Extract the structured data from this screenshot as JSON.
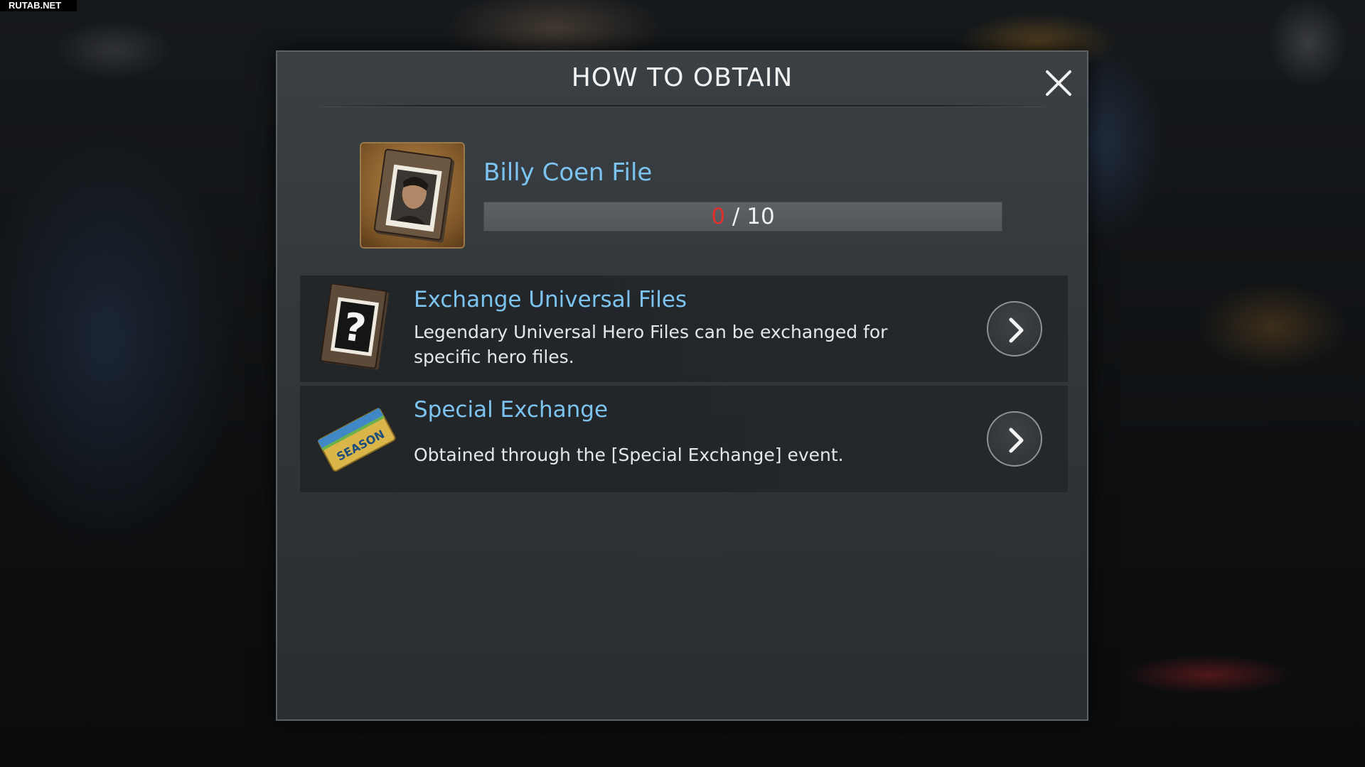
{
  "watermark": "RUTAB.NET",
  "dialog": {
    "title": "HOW TO OBTAIN",
    "close_icon": "close-icon"
  },
  "item": {
    "name": "Billy Coen File",
    "icon": "hero-file-portrait-icon",
    "owned": "0",
    "separator": " / ",
    "required": "10",
    "progress_fraction": 0
  },
  "sources": [
    {
      "title": "Exchange Universal Files",
      "description": "Legendary Universal Hero Files can be exchanged for specific hero files.",
      "icon": "universal-file-question-icon",
      "action_icon": "chevron-right-icon"
    },
    {
      "title": "Special Exchange",
      "description": "Obtained through the [Special Exchange] event.",
      "icon": "season-ticket-icon",
      "action_icon": "chevron-right-icon"
    }
  ],
  "colors": {
    "accent_text": "#7cc3f0",
    "progress_current": "#e0302e"
  }
}
